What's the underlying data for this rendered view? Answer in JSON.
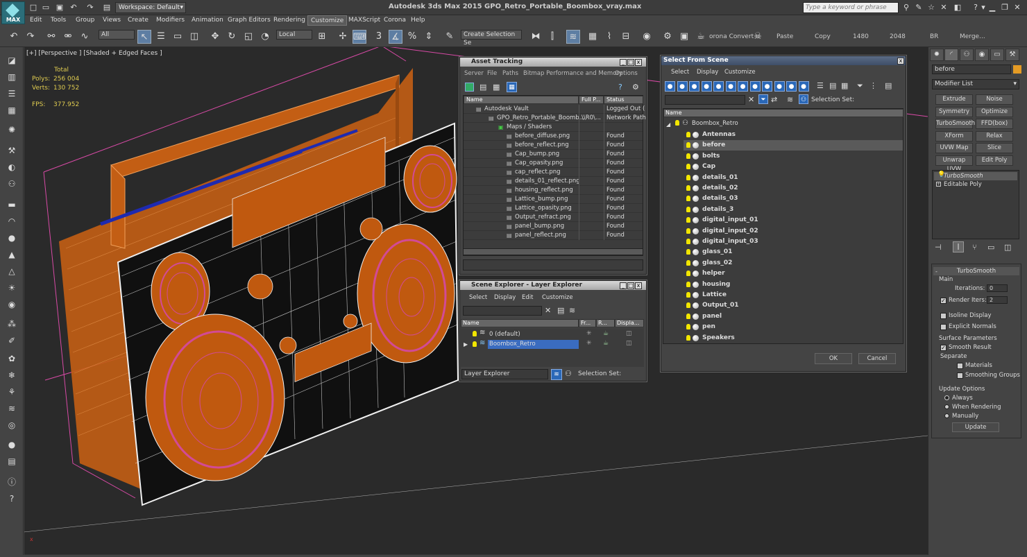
{
  "app": {
    "title": "Autodesk 3ds Max  2015     GPO_Retro_Portable_Boombox_vray.max",
    "logo_text": "MAX",
    "workspace": "Workspace: Default",
    "search_placeholder": "Type a keyword or phrase"
  },
  "menu": [
    "Edit",
    "Tools",
    "Group",
    "Views",
    "Create",
    "Modifiers",
    "Animation",
    "Graph Editors",
    "Rendering",
    "Customize",
    "MAXScript",
    "Corona",
    "Help"
  ],
  "menu_active": "Customize",
  "toolbar": {
    "filter": "All",
    "coord": "Local",
    "selection_set": "Create Selection Se",
    "corona_convert": "orona Convert",
    "paste": "Paste",
    "copy": "Copy",
    "w": "1480",
    "h": "2048",
    "br": "BR",
    "merge": "Merge..."
  },
  "viewport": {
    "label": "[+] [Perspective ] [Shaded + Edged Faces ]",
    "stats_header": "Total",
    "polys_label": "Polys:",
    "polys": "256 004",
    "verts_label": "Verts:",
    "verts": "130 752",
    "fps_label": "FPS:",
    "fps": "377.952"
  },
  "asset_tracking": {
    "title": "Asset Tracking",
    "menu": [
      "Server",
      "File",
      "Paths",
      "Bitmap Performance and Memory",
      "Options"
    ],
    "columns": [
      "Name",
      "Full P...",
      "Status"
    ],
    "rows": [
      {
        "name": "Autodesk Vault",
        "path": "",
        "status": "Logged Out (",
        "indent": 1
      },
      {
        "name": "GPO_Retro_Portable_Boomb...",
        "path": "\\\\R0\\...",
        "status": "Network Path",
        "indent": 2
      },
      {
        "name": "Maps / Shaders",
        "path": "",
        "status": "",
        "indent": 3
      },
      {
        "name": "before_diffuse.png",
        "path": "",
        "status": "Found",
        "indent": 4
      },
      {
        "name": "before_reflect.png",
        "path": "",
        "status": "Found",
        "indent": 4
      },
      {
        "name": "Cap_bump.png",
        "path": "",
        "status": "Found",
        "indent": 4
      },
      {
        "name": "Cap_opasity.png",
        "path": "",
        "status": "Found",
        "indent": 4
      },
      {
        "name": "cap_reflect.png",
        "path": "",
        "status": "Found",
        "indent": 4
      },
      {
        "name": "details_01_reflect.png",
        "path": "",
        "status": "Found",
        "indent": 4
      },
      {
        "name": "housing_reflect.png",
        "path": "",
        "status": "Found",
        "indent": 4
      },
      {
        "name": "Lattice_bump.png",
        "path": "",
        "status": "Found",
        "indent": 4
      },
      {
        "name": "Lattice_opasity.png",
        "path": "",
        "status": "Found",
        "indent": 4
      },
      {
        "name": "Output_refract.png",
        "path": "",
        "status": "Found",
        "indent": 4
      },
      {
        "name": "panel_bump.png",
        "path": "",
        "status": "Found",
        "indent": 4
      },
      {
        "name": "panel_reflect.png",
        "path": "",
        "status": "Found",
        "indent": 4
      }
    ]
  },
  "scene_explorer": {
    "title": "Scene Explorer - Layer Explorer",
    "menu": [
      "Select",
      "Display",
      "Edit",
      "Customize"
    ],
    "columns": [
      "Name",
      "Fr...",
      "R...",
      "Displa..."
    ],
    "rows": [
      "0 (default)",
      "Boombox_Retro"
    ],
    "footer_dropdown": "Layer Explorer",
    "selection_set": "Selection Set:"
  },
  "select_from_scene": {
    "title": "Select From Scene",
    "menu": [
      "Select",
      "Display",
      "Customize"
    ],
    "selection_set": "Selection Set:",
    "column": "Name",
    "root": "Boombox_Retro",
    "items": [
      "Antennas",
      "before",
      "bolts",
      "Cap",
      "details_01",
      "details_02",
      "details_03",
      "details_3",
      "digital_input_01",
      "digital_input_02",
      "digital_input_03",
      "glass_01",
      "glass_02",
      "helper",
      "housing",
      "Lattice",
      "Output_01",
      "panel",
      "pen",
      "Speakers"
    ],
    "selected": "before",
    "ok": "OK",
    "cancel": "Cancel"
  },
  "command_panel": {
    "object_name": "before",
    "modifier_list": "Modifier List",
    "buttons": [
      "Extrude",
      "Noise",
      "Symmetry",
      "Optimize",
      "TurboSmooth",
      "FFD(box)",
      "XForm",
      "Relax",
      "UVW Map",
      "Slice",
      "Unwrap UVW",
      "Edit Poly"
    ],
    "stack": [
      "TurboSmooth",
      "Editable Poly"
    ],
    "rollout": {
      "title": "TurboSmooth",
      "main": "Main",
      "iterations_label": "Iterations:",
      "iterations": "0",
      "render_iters_label": "Render Iters:",
      "render_iters": "2",
      "isoline": "Isoline Display",
      "explicit": "Explicit Normals",
      "surface": "Surface Parameters",
      "smooth": "Smooth Result",
      "separate": "Separate",
      "materials": "Materials",
      "smoothing": "Smoothing Groups",
      "update_options": "Update Options",
      "always": "Always",
      "when_rendering": "When Rendering",
      "manually": "Manually",
      "update": "Update"
    }
  },
  "colors": {
    "wire_orange": "#c85a10",
    "wire_white": "#f0f0f0",
    "speaker_pink": "#d24a96",
    "handle_blue": "#1e2ab0",
    "selection_blue": "#3a6cc0"
  }
}
